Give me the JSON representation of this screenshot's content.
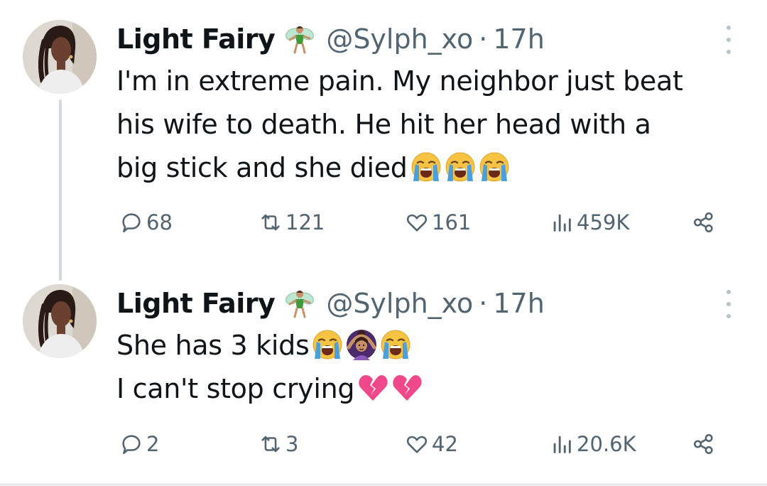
{
  "tweets": [
    {
      "author": {
        "name": "Light Fairy",
        "badge_icon": "fairy-emoji",
        "handle": "@Sylph_xo",
        "separator": "·",
        "time": "17h"
      },
      "lines": [
        "I'm in extreme pain. My neighbor just beat",
        "his wife to death. He hit her head with a",
        "big stick and she died"
      ],
      "trailing_emojis": [
        "loudly-crying-face",
        "loudly-crying-face",
        "loudly-crying-face"
      ],
      "stats": {
        "replies": "68",
        "reposts": "121",
        "likes": "161",
        "views": "459K"
      }
    },
    {
      "author": {
        "name": "Light Fairy",
        "badge_icon": "fairy-emoji",
        "handle": "@Sylph_xo",
        "separator": "·",
        "time": "17h"
      },
      "lines": [
        "She has 3 kids",
        "I can't stop crying"
      ],
      "line1_emojis": [
        "loudly-crying-face",
        "woman-gesturing-ok",
        "loudly-crying-face"
      ],
      "line2_emojis": [
        "broken-heart",
        "broken-heart"
      ],
      "stats": {
        "replies": "2",
        "reposts": "3",
        "likes": "42",
        "views": "20.6K"
      }
    }
  ],
  "colors": {
    "text": "#0f1419",
    "secondary": "#536471",
    "thread_line": "#cfd9de",
    "broken_heart": "#f0488a",
    "cry_face": "#f6c343",
    "tears": "#4a9fe0"
  }
}
